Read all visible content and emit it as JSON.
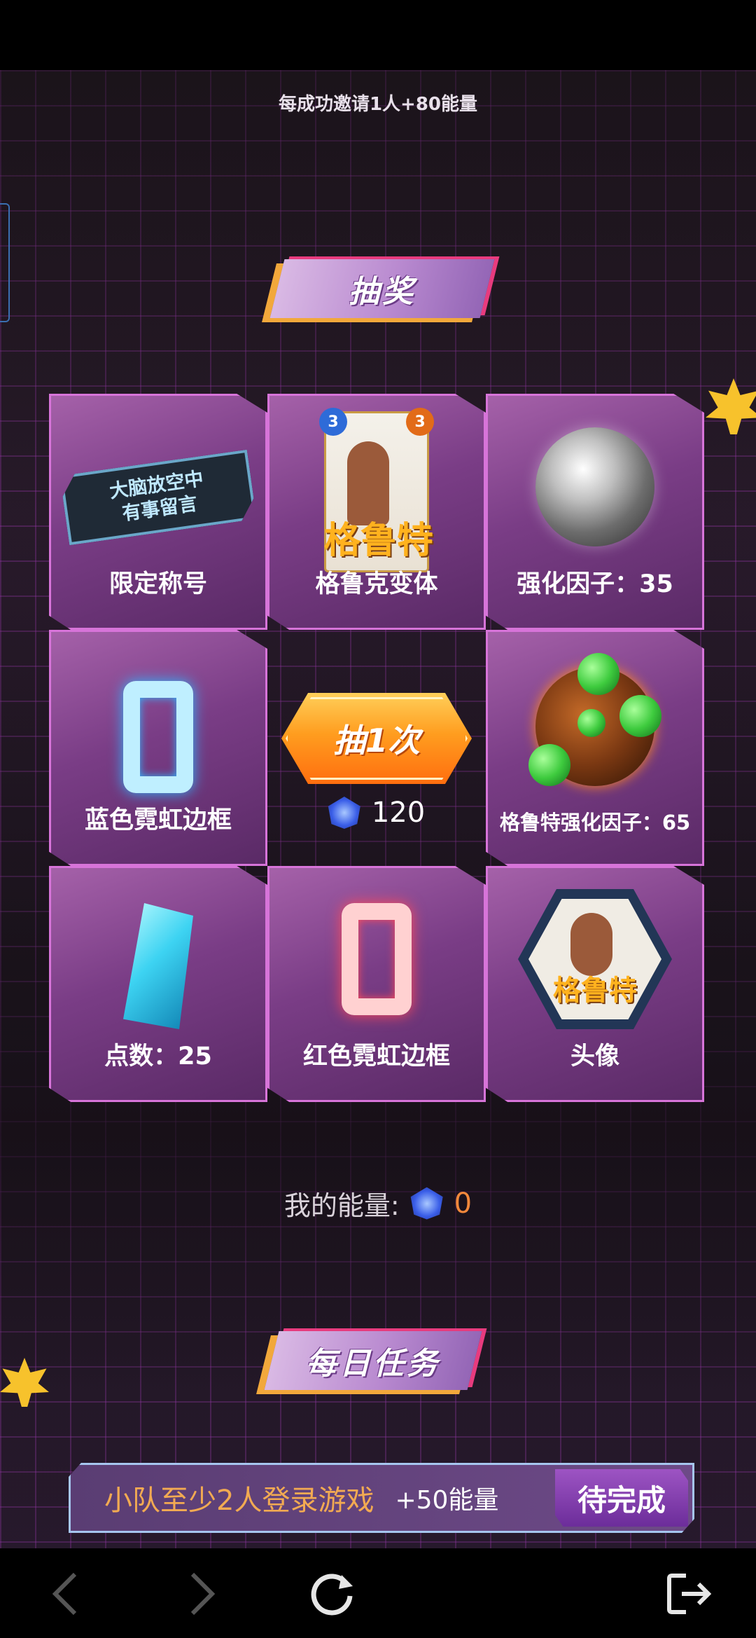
{
  "header": {
    "invite_tip": "每成功邀请1人+80能量"
  },
  "lottery": {
    "banner_title": "抽奖",
    "prizes": [
      {
        "label": "限定称号",
        "plate_line1": "大脑放空中",
        "plate_line2": "有事留言",
        "icon": "title-plate-icon"
      },
      {
        "label": "格鲁克变体",
        "card_cost": "3",
        "card_power": "3",
        "card_logo": "格鲁特",
        "icon": "variant-card-icon"
      },
      {
        "label": "强化因子：35",
        "icon": "silver-orb-icon"
      },
      {
        "label": "蓝色霓虹边框",
        "icon": "blue-neon-frame-icon"
      },
      {
        "label": "格鲁特强化因子：65",
        "icon": "bronze-orb-icon"
      },
      {
        "label": "点数：25",
        "icon": "crystal-icon"
      },
      {
        "label": "红色霓虹边框",
        "icon": "red-neon-frame-icon"
      },
      {
        "label": "头像",
        "avatar_logo": "格鲁特",
        "icon": "avatar-icon"
      }
    ],
    "draw_button_label": "抽1次",
    "draw_cost": "120",
    "cost_icon": "energy-gem-icon"
  },
  "energy": {
    "label": "我的能量:",
    "value": "0",
    "icon": "energy-gem-icon"
  },
  "daily": {
    "banner_title": "每日任务",
    "tasks": [
      {
        "text": "小队至少2人登录游戏",
        "reward": "+50能量",
        "status": "待完成"
      }
    ]
  },
  "nav": {
    "back_icon": "chevron-left-icon",
    "forward_icon": "chevron-right-icon",
    "refresh_icon": "refresh-icon",
    "exit_icon": "exit-icon"
  },
  "colors": {
    "accent_orange": "#ff9d1f",
    "cell_border": "#d774d9",
    "energy_value": "#f2883b",
    "task_text": "#f2aa52"
  }
}
